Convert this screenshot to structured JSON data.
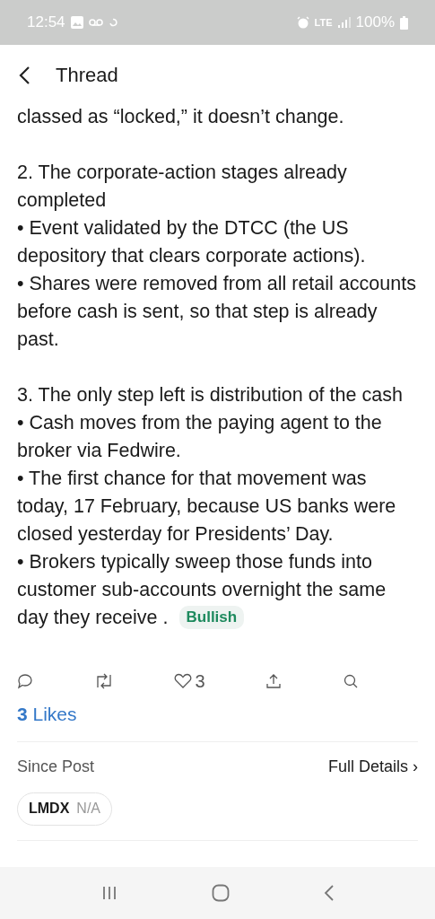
{
  "status_bar": {
    "time": "12:54",
    "network": "LTE",
    "battery": "100%"
  },
  "header": {
    "title": "Thread"
  },
  "post": {
    "sections": [
      {
        "lines": [
          "classed as “locked,” it doesn’t change."
        ]
      },
      {
        "lines": [
          "2. The corporate-action stages already completed",
          "• Event validated by the DTCC (the US depository that clears corporate actions).",
          "• Shares were removed from all retail accounts before cash is sent, so that step is already past."
        ]
      },
      {
        "lines": [
          "3. The only step left is distribution of the cash",
          "• Cash moves from the paying agent to the broker via Fedwire.",
          "• The first chance for that movement was today, 17 February, because US banks were closed yesterday for Presidents’ Day.",
          "• Brokers typically sweep those funds into customer sub-accounts overnight the same day they receive ."
        ]
      }
    ],
    "sentiment": "Bullish"
  },
  "actions": {
    "like_count": "3",
    "likes_summary": "**3** Likes"
  },
  "since_post": {
    "label": "Since Post",
    "link": "Full Details ›",
    "ticker": {
      "symbol": "LMDX",
      "change": "N/A"
    }
  }
}
